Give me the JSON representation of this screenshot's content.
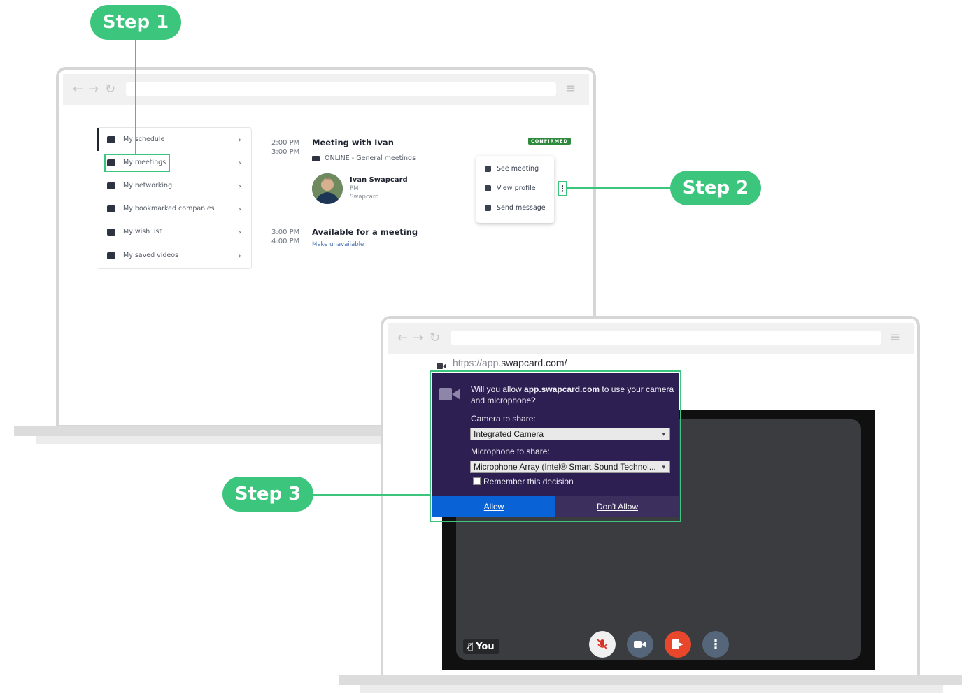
{
  "steps": {
    "step1": "Step 1",
    "step2": "Step 2",
    "step3": "Step 3"
  },
  "sidebar": {
    "items": [
      {
        "label": "My schedule",
        "icon": "calendar-icon"
      },
      {
        "label": "My meetings",
        "icon": "meetings-icon"
      },
      {
        "label": "My networking",
        "icon": "people-icon"
      },
      {
        "label": "My bookmarked companies",
        "icon": "bookmark-icon"
      },
      {
        "label": "My wish list",
        "icon": "wishlist-icon"
      },
      {
        "label": "My saved videos",
        "icon": "video-icon"
      }
    ]
  },
  "schedule": {
    "meeting": {
      "start": "2:00 PM",
      "end": "3:00 PM",
      "title": "Meeting with Ivan",
      "status": "CONFIRMED",
      "location": "ONLINE - General meetings",
      "person_name": "Ivan Swapcard",
      "person_role": "PM",
      "person_company": "Swapcard"
    },
    "slot": {
      "start": "3:00 PM",
      "end": "4:00 PM",
      "title": "Available for a meeting",
      "link": "Make unavailable"
    }
  },
  "popover": {
    "items": [
      "See meeting",
      "View profile",
      "Send message"
    ]
  },
  "browser2": {
    "url_prefix": "https://app.",
    "url_domain": "swapcard.com/"
  },
  "permission": {
    "question_pre": "Will you allow ",
    "question_domain": "app.swapcard.com",
    "question_post": " to use your camera",
    "question_line2": "and microphone?",
    "camera_label": "Camera to share:",
    "camera_value": "Integrated Camera",
    "mic_label": "Microphone to share:",
    "mic_value": "Microphone Array (Intel® Smart Sound Technol...",
    "remember_label": "Remember this decision",
    "allow": "Allow",
    "deny": "Don't Allow"
  },
  "video": {
    "you_label": "You"
  },
  "colors": {
    "green": "#3cc67d",
    "confirmed": "#2f8a3e",
    "dialog_bg": "#2d1f52",
    "allow_blue": "#0a63d6",
    "leave_orange": "#e9472c"
  }
}
